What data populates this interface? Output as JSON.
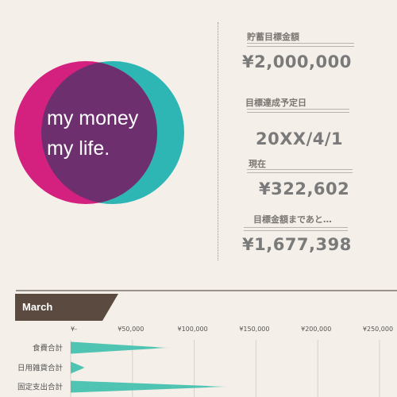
{
  "logo": {
    "line1": "my money",
    "line2": "my life.",
    "colors": {
      "left": "#d4217f",
      "right": "#2db6b4",
      "overlap": "#6e2f6e"
    }
  },
  "summary": [
    {
      "label": "貯蓄目標金額",
      "value": "¥2,000,000"
    },
    {
      "label": "目標達成予定日",
      "value": "20XX/4/1"
    },
    {
      "label": "現在",
      "value": "¥322,602"
    },
    {
      "label": "目標金額まであと…",
      "value": "¥1,677,398"
    }
  ],
  "month": {
    "label": "March",
    "color": "#5b4a40"
  },
  "chart_data": {
    "type": "bar",
    "orientation": "horizontal",
    "title": "March",
    "categories": [
      "食費合計",
      "日用雑貨合計",
      "固定支出合計"
    ],
    "values": [
      79000,
      11500,
      127500
    ],
    "xlim": [
      0,
      250000
    ],
    "xticks": [
      0,
      50000,
      100000,
      150000,
      200000,
      250000
    ],
    "xtick_labels": [
      "¥-",
      "¥50,000",
      "¥100,000",
      "¥150,000",
      "¥200,000",
      "¥250,000"
    ],
    "bar_color": "#4fc4b2",
    "grid": true
  }
}
